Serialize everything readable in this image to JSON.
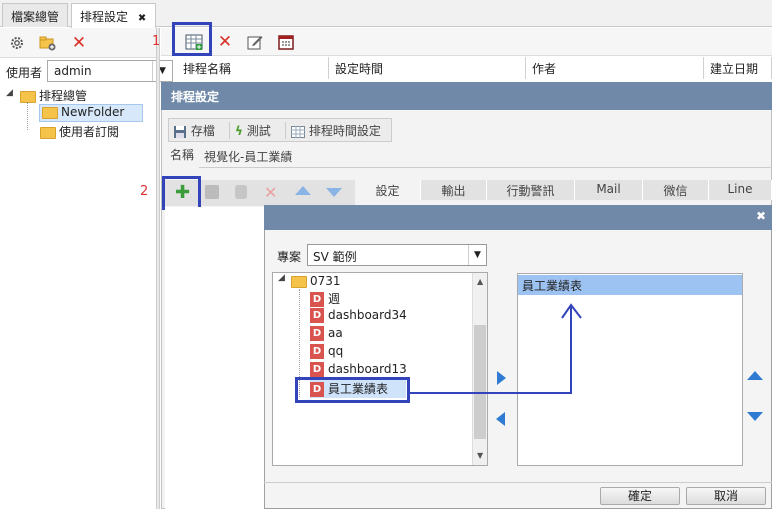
{
  "tabs": [
    {
      "label": "檔案總管"
    },
    {
      "label": "排程設定"
    }
  ],
  "tab_close": "✖",
  "markers": {
    "one": "1",
    "two": "2"
  },
  "user": {
    "label": "使用者",
    "value": "admin"
  },
  "tree": {
    "root": "排程總管",
    "folder1": "NewFolder",
    "folder2": "使用者訂閱"
  },
  "columns": [
    "排程名稱",
    "設定時間",
    "作者",
    "建立日期"
  ],
  "panel": {
    "title": "排程設定",
    "save": "存檔",
    "test": "測試",
    "time_setting": "排程時間設定",
    "name_label": "名稱",
    "name_value": "視覺化-員工業績",
    "nav_tabs": [
      "設定",
      "輸出",
      "行動警訊",
      "Mail",
      "微信",
      "Line"
    ]
  },
  "dialog": {
    "close": "✖",
    "project_label": "專案",
    "project_value": "SV 範例",
    "folder": "0731",
    "items": [
      "週",
      "dashboard34",
      "aa",
      "qq",
      "dashboard13",
      "員工業績表"
    ],
    "selected_item": "員工業績表",
    "right_items": [
      "員工業績表"
    ],
    "ok": "確定",
    "cancel": "取消"
  },
  "colors": {
    "highlight": "#3344bb",
    "accent": "#2f7bd3",
    "header": "#7089a8",
    "selected": "#9dc3f2"
  }
}
